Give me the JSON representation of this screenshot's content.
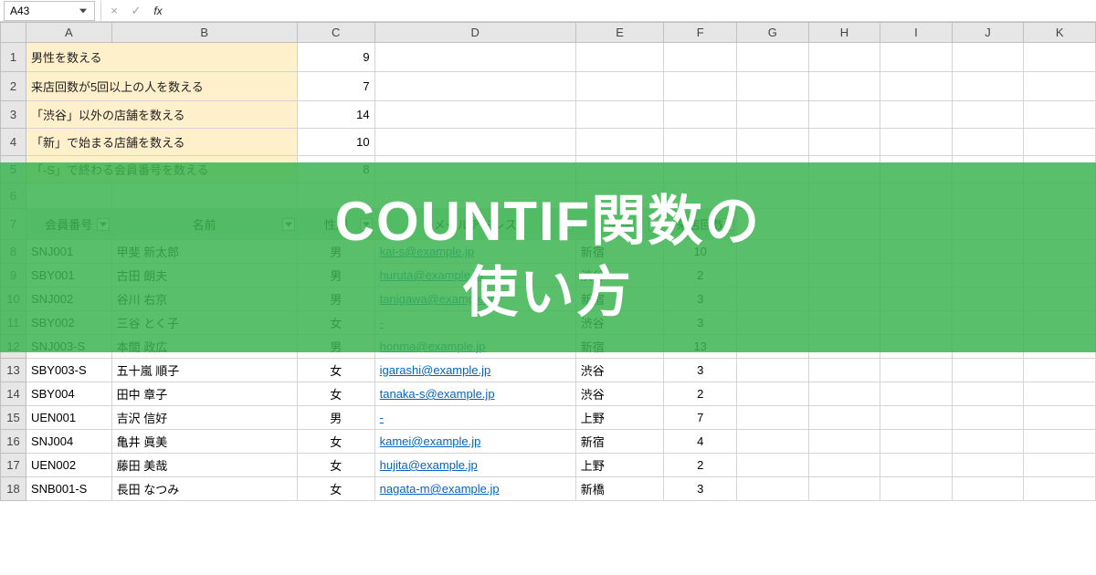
{
  "namebox": {
    "value": "A43"
  },
  "formula_bar": {
    "cancel_icon": "×",
    "confirm_icon": "✓",
    "fx_label": "fx",
    "value": ""
  },
  "columns": [
    "A",
    "B",
    "C",
    "D",
    "E",
    "F",
    "G",
    "H",
    "I",
    "J",
    "K"
  ],
  "prompts": [
    {
      "label": "男性を数える",
      "result": 9
    },
    {
      "label": "来店回数が5回以上の人を数える",
      "result": 7
    },
    {
      "label": "「渋谷」以外の店舗を数える",
      "result": 14
    },
    {
      "label": "「新」で始まる店舗を数える",
      "result": 10
    },
    {
      "label": "「-S」で終わる会員番号を数える",
      "result": 8
    }
  ],
  "table": {
    "headers": [
      "会員番号",
      "名前",
      "性別",
      "メールアドレス",
      "店舗",
      "来店回数"
    ],
    "rows": [
      {
        "id": "SNJ001",
        "name": "甲斐 新太郎",
        "gender": "男",
        "email": "kai-s@example.jp",
        "store": "新宿",
        "visits": 10
      },
      {
        "id": "SBY001",
        "name": "古田 朗夫",
        "gender": "男",
        "email": "huruta@example.jp",
        "store": "渋谷",
        "visits": 2
      },
      {
        "id": "SNJ002",
        "name": "谷川 右京",
        "gender": "男",
        "email": "tanigawa@example.jp",
        "store": "新宿",
        "visits": 3
      },
      {
        "id": "SBY002",
        "name": "三谷 とく子",
        "gender": "女",
        "email": "-",
        "store": "渋谷",
        "visits": 3
      },
      {
        "id": "SNJ003-S",
        "name": "本間 政広",
        "gender": "男",
        "email": "honma@example.jp",
        "store": "新宿",
        "visits": 13
      },
      {
        "id": "SBY003-S",
        "name": "五十嵐 順子",
        "gender": "女",
        "email": "igarashi@example.jp",
        "store": "渋谷",
        "visits": 3
      },
      {
        "id": "SBY004",
        "name": "田中 章子",
        "gender": "女",
        "email": "tanaka-s@example.jp",
        "store": "渋谷",
        "visits": 2
      },
      {
        "id": "UEN001",
        "name": "吉沢 信好",
        "gender": "男",
        "email": "-",
        "store": "上野",
        "visits": 7
      },
      {
        "id": "SNJ004",
        "name": "亀井 眞美",
        "gender": "女",
        "email": "kamei@example.jp",
        "store": "新宿",
        "visits": 4
      },
      {
        "id": "UEN002",
        "name": "藤田 美哉",
        "gender": "女",
        "email": "hujita@example.jp",
        "store": "上野",
        "visits": 2
      },
      {
        "id": "SNB001-S",
        "name": "長田 なつみ",
        "gender": "女",
        "email": "nagata-m@example.jp",
        "store": "新橋",
        "visits": 3
      }
    ]
  },
  "overlay": {
    "line1": "COUNTIF関数の",
    "line2": "使い方"
  }
}
